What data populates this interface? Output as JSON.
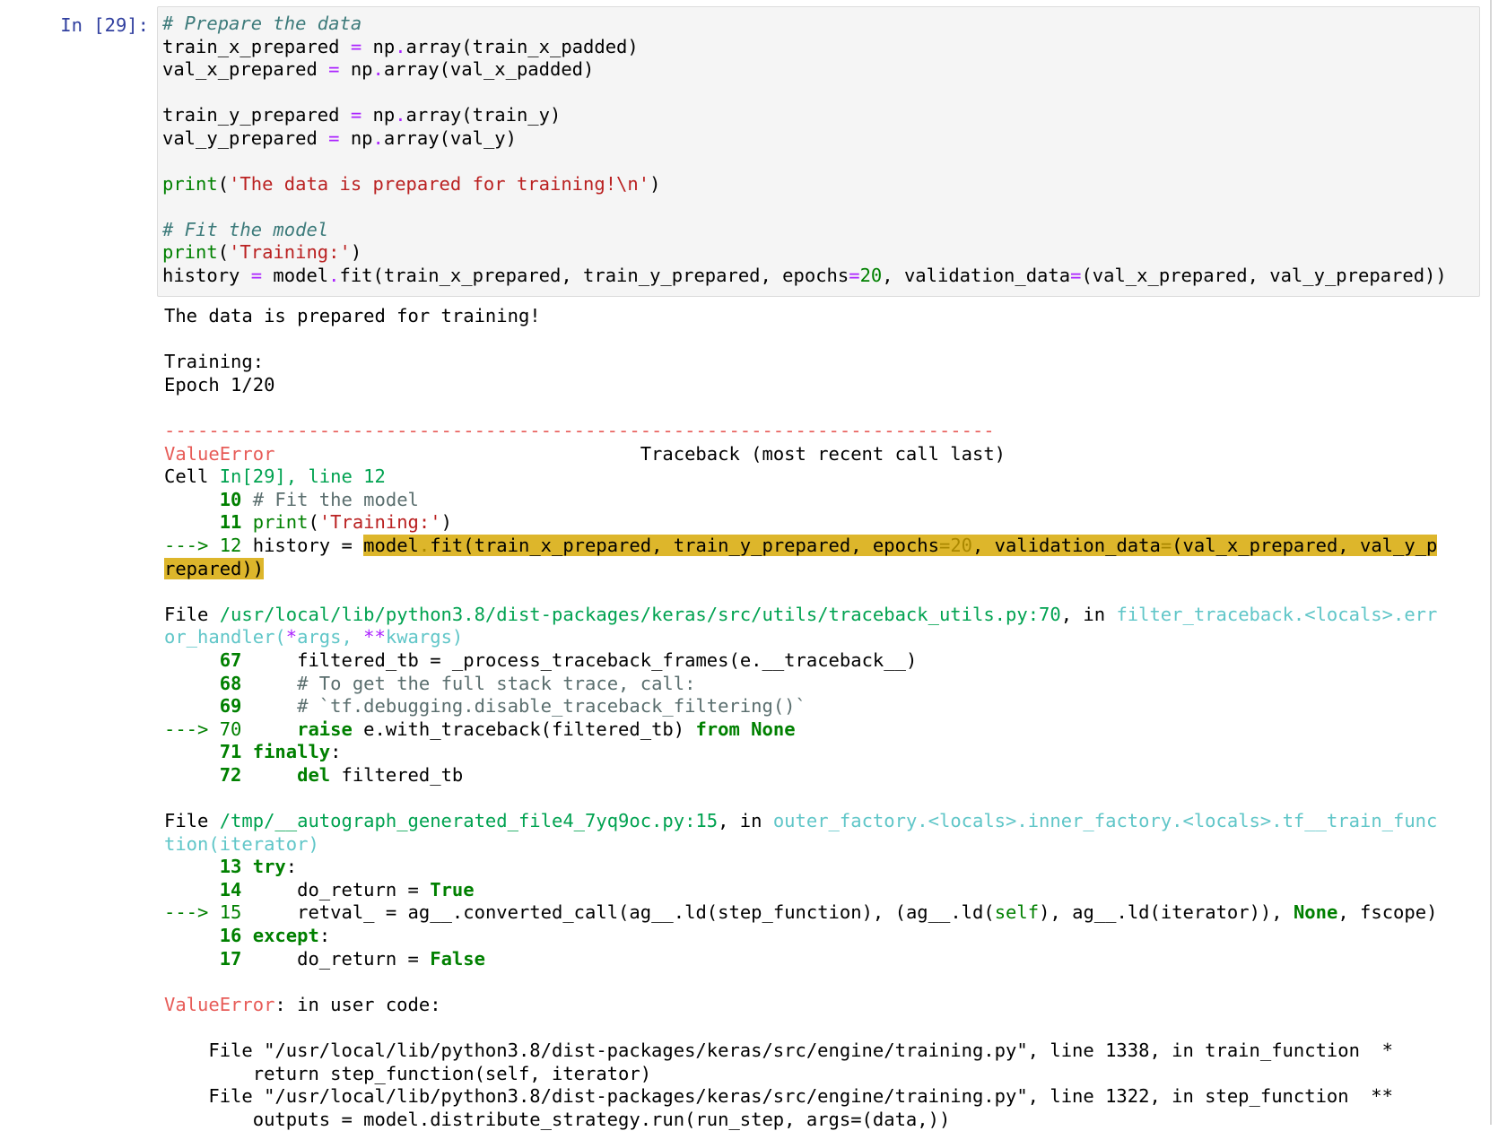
{
  "cell": {
    "prompt": "In [29]:",
    "input_lines": [
      "# Prepare the data",
      "train_x_prepared = np.array(train_x_padded)",
      "val_x_prepared = np.array(val_x_padded)",
      "",
      "train_y_prepared = np.array(train_y)",
      "val_y_prepared = np.array(val_y)",
      "",
      "print('The data is prepared for training!\\n')",
      "",
      "# Fit the model",
      "print('Training:')",
      "history = model.fit(train_x_prepared, train_y_prepared, epochs=20, validation_data=(val_x_prepared, val_y_prepared))"
    ]
  },
  "output": {
    "stdout": [
      "The data is prepared for training!",
      "",
      "Training:",
      "Epoch 1/20"
    ],
    "separator": "---------------------------------------------------------------------------",
    "error_name": "ValueError",
    "traceback_header": "Traceback (most recent call last)",
    "cell_ref": {
      "prefix": "Cell ",
      "link": "In[29], line 12"
    },
    "frame1": {
      "lines": [
        {
          "no": "10",
          "code": "# Fit the model"
        },
        {
          "no": "11",
          "code": "print('Training:')"
        }
      ],
      "arrow": "---> 12",
      "current_prefix": "history = ",
      "current_highlight_1": "model.fit(train_x_prepared, train_y_prepared, epochs=20, validation_data=(val_x_prepared, val_y_p",
      "current_highlight_2": "repared))"
    },
    "frame2": {
      "file_label": "File ",
      "path": "/usr/local/lib/python3.8/dist-packages/keras/src/utils/traceback_utils.py:70",
      "in_label": ", in ",
      "func_1": "filter_traceback.<locals>.err",
      "func_2": "or_handler(*args, **kwargs)",
      "lines": [
        {
          "no": "67",
          "code": "    filtered_tb = _process_traceback_frames(e.__traceback__)"
        },
        {
          "no": "68",
          "code": "    # To get the full stack trace, call:"
        },
        {
          "no": "69",
          "code": "    # `tf.debugging.disable_traceback_filtering()`"
        },
        {
          "no": "70",
          "code": "    raise e.with_traceback(filtered_tb) from None"
        },
        {
          "no": "71",
          "code": "finally:"
        },
        {
          "no": "72",
          "code": "    del filtered_tb"
        }
      ]
    },
    "frame3": {
      "file_label": "File ",
      "path": "/tmp/__autograph_generated_file4_7yq9oc.py:15",
      "in_label": ", in ",
      "func_1": "outer_factory.<locals>.inner_factory.<locals>.tf__train_func",
      "func_2": "tion(iterator)",
      "lines": [
        {
          "no": "13",
          "code": "try:"
        },
        {
          "no": "14",
          "code": "    do_return = True"
        },
        {
          "no": "15",
          "code": "    retval_ = ag__.converted_call(ag__.ld(step_function), (ag__.ld(self), ag__.ld(iterator)), None, fscope)"
        },
        {
          "no": "16",
          "code": "except:"
        },
        {
          "no": "17",
          "code": "    do_return = False"
        }
      ]
    },
    "final_error": {
      "name": "ValueError",
      "message": ": in user code:"
    },
    "user_code_lines": [
      "    File \"/usr/local/lib/python3.8/dist-packages/keras/src/engine/training.py\", line 1338, in train_function  *",
      "        return step_function(self, iterator)",
      "    File \"/usr/local/lib/python3.8/dist-packages/keras/src/engine/training.py\", line 1322, in step_function  **",
      "        outputs = model.distribute_strategy.run(run_step, args=(data,))"
    ]
  }
}
